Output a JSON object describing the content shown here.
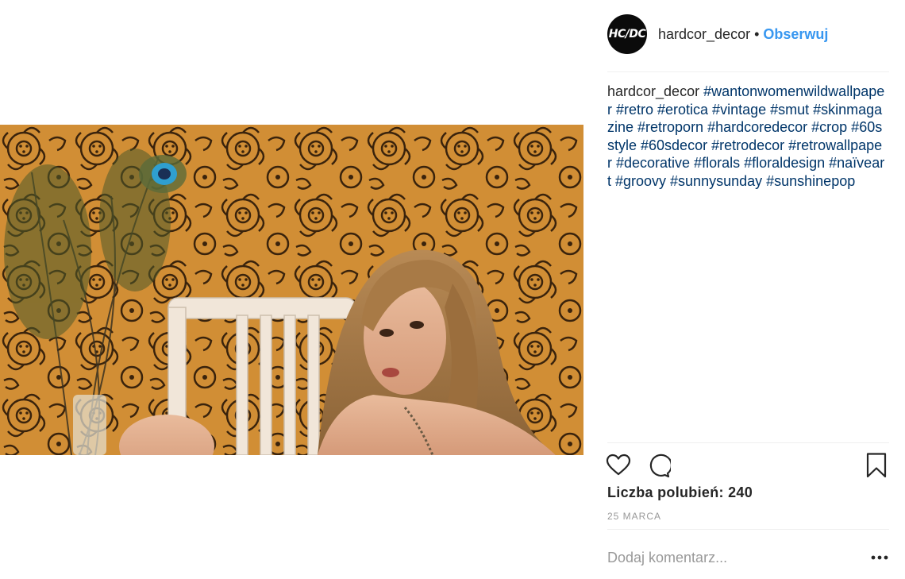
{
  "post": {
    "username": "hardcor_decor",
    "separator": "•",
    "follow_label": "Obserwuj",
    "avatar_text": "HC/DC",
    "caption_user": "hardcor_decor",
    "caption_text": "#wantonwomenwildwallpaper #retro #erotica #vintage #smut #skinmagazine #retroporn #hardcoredecor #crop #60sstyle #60sdecor #retrodecor #retrowallpaper #decorative #florals #floraldesign #naïveart #groovy #sunnysunday #sunshinepop",
    "likes_label": "Liczba polubień: 240",
    "date": "25 MARCA",
    "comment_placeholder": "Dodaj komentarz..."
  },
  "icons": {
    "like": "heart-icon",
    "comment": "comment-bubble-icon",
    "save": "bookmark-icon",
    "more": "more-options-icon"
  },
  "colors": {
    "follow": "#3897f0",
    "hashtag": "#003569",
    "wallpaper": "#c9822c",
    "divider": "#efefef"
  }
}
